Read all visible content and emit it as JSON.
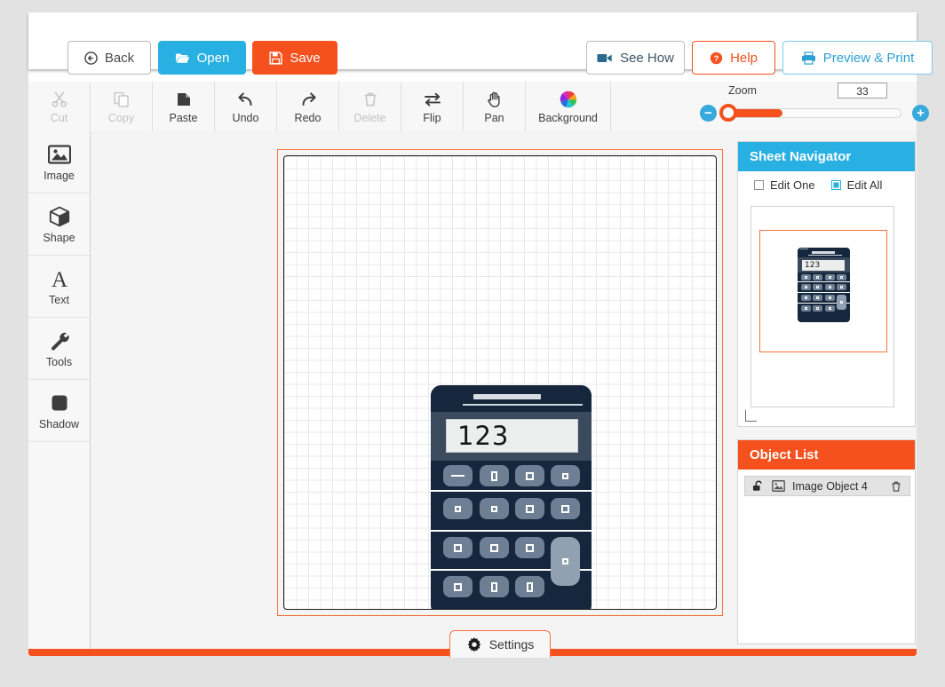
{
  "topbar": {
    "back": "Back",
    "open": "Open",
    "save": "Save",
    "see_how": "See How",
    "help": "Help",
    "preview_print": "Preview & Print",
    "icons": {
      "back": "back-arrow-icon",
      "open": "folder-open-icon",
      "save": "floppy-disk-icon",
      "see_how": "video-camera-icon",
      "help": "question-mark-icon",
      "preview": "printer-icon"
    },
    "colors": {
      "open_bg": "#29b0e2",
      "save_bg": "#f4511e",
      "help_border": "#f4511e",
      "preview_text": "#2e9fd4"
    }
  },
  "ribbon": {
    "tools": [
      {
        "label": "Cut",
        "icon": "scissors-icon",
        "disabled": true
      },
      {
        "label": "Copy",
        "icon": "copy-icon",
        "disabled": true
      },
      {
        "label": "Paste",
        "icon": "clipboard-icon",
        "disabled": false
      },
      {
        "label": "Undo",
        "icon": "undo-arrow-icon",
        "disabled": false
      },
      {
        "label": "Redo",
        "icon": "redo-arrow-icon",
        "disabled": false
      },
      {
        "label": "Delete",
        "icon": "trash-icon",
        "disabled": true
      },
      {
        "label": "Flip",
        "icon": "flip-arrows-icon",
        "disabled": false
      },
      {
        "label": "Pan",
        "icon": "hand-icon",
        "disabled": false
      },
      {
        "label": "Background",
        "icon": "color-wheel-icon",
        "disabled": false
      }
    ],
    "zoom": {
      "label": "Zoom",
      "value": "33",
      "percent": 33,
      "minus": "−",
      "plus": "+",
      "fill_color": "#f4511e",
      "button_color": "#37a9dd"
    }
  },
  "sidebar": {
    "items": [
      {
        "label": "Image",
        "icon": "image-icon"
      },
      {
        "label": "Shape",
        "icon": "cube-icon"
      },
      {
        "label": "Text",
        "icon": "letter-a-icon"
      },
      {
        "label": "Tools",
        "icon": "wrench-icon"
      },
      {
        "label": "Shadow",
        "icon": "rounded-square-icon"
      }
    ]
  },
  "canvas": {
    "selection_color": "#f4743e",
    "artwork": {
      "name": "calculator-illustration",
      "display_value": "123",
      "body_color": "#16263c",
      "screen_color": "#eceded",
      "key_color": "#6e7f93"
    }
  },
  "sheet_navigator": {
    "title": "Sheet Navigator",
    "edit_one": {
      "label": "Edit One",
      "checked": false
    },
    "edit_all": {
      "label": "Edit All",
      "checked": true
    },
    "thumbnail": {
      "display_value": "123"
    }
  },
  "object_list": {
    "title": "Object List",
    "rows": [
      {
        "name": "Image Object 4",
        "lock_icon": "unlock-icon",
        "type_icon": "image-icon",
        "delete_icon": "trash-icon"
      }
    ]
  },
  "bottom": {
    "settings": "Settings",
    "settings_icon": "gear-icon",
    "bar_color": "#f4511e"
  }
}
